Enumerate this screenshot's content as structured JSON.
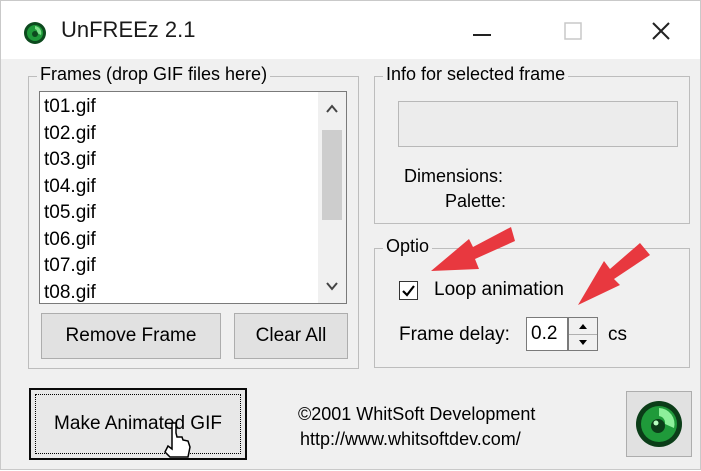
{
  "window": {
    "title": "UnFREEz 2.1",
    "controls": [
      "minimize",
      "maximize",
      "close"
    ]
  },
  "frames": {
    "legend": "Frames (drop GIF files here)",
    "items": [
      "t01.gif",
      "t02.gif",
      "t03.gif",
      "t04.gif",
      "t05.gif",
      "t06.gif",
      "t07.gif",
      "t08.gif"
    ],
    "remove_label": "Remove Frame",
    "clear_label": "Clear All"
  },
  "info": {
    "legend": "Info for selected frame",
    "dimensions_label": "Dimensions:",
    "palette_label": "Palette:"
  },
  "options": {
    "legend": "Optio",
    "loop_label": "Loop animation",
    "loop_checked": true,
    "delay_label": "Frame delay:",
    "delay_value": "0.2",
    "delay_unit": "cs"
  },
  "footer": {
    "make_label": "Make Animated GIF",
    "copyright": "©2001 WhitSoft Development",
    "url": "http://www.whitsoftdev.com/"
  },
  "colors": {
    "annotation_arrow": "#e8383f",
    "logo_green": "#1f9a3a"
  }
}
